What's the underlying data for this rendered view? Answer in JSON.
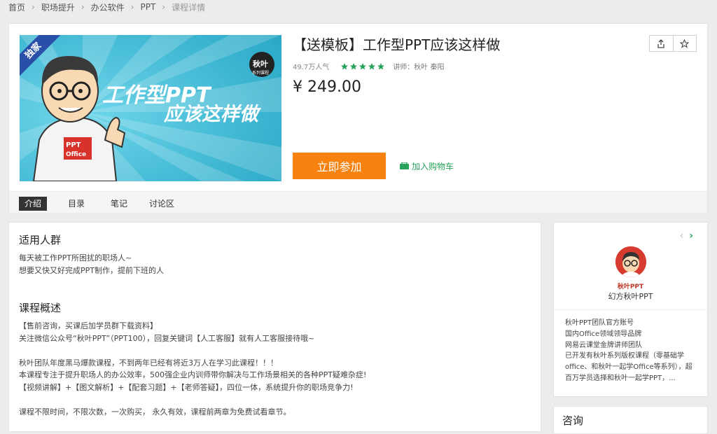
{
  "breadcrumb": [
    "首页",
    "职场提升",
    "办公软件",
    "PPT",
    "课程详情"
  ],
  "cover": {
    "badge": "独家",
    "line1": "工作型PPT",
    "line2": "应该这样做",
    "logo_name": "秋叶",
    "logo_sub": "系列课程",
    "shirt_line1": "PPT",
    "shirt_line2": "Office"
  },
  "course": {
    "title": "【送模板】工作型PPT应该这样做",
    "popularity": "49.7万人气",
    "rating_stars": 5,
    "instructor": "讲师：秋叶 秦阳",
    "price": "¥ 249.00",
    "join_label": "立即参加",
    "cart_label": "加入购物车"
  },
  "actions": {
    "share_icon": "share-icon",
    "favorite_icon": "star-icon"
  },
  "tabs": [
    "介绍",
    "目录",
    "笔记",
    "讨论区"
  ],
  "active_tab": "介绍",
  "intro": {
    "audience_title": "适用人群",
    "audience_lines": [
      "每天被工作PPT所困扰的职场人~",
      "想要又快又好完成PPT制作，提前下班的人"
    ],
    "overview_title": "课程概述",
    "overview_lines": [
      "【售前咨询，买课后加学员群下载资料】",
      "关注微信公众号“秋叶PPT”（PPT100），回复关键词【人工客服】就有人工客服接待哦~",
      "",
      "秋叶团队年度黑马爆款课程，不到两年已经有将近3万人在学习此课程！！！",
      "本课程专注于提升职场人的办公效率，500强企业内训师带你解决与工作场景相关的各种PPT疑难杂症!",
      "【视频讲解】+【图文解析】+【配套习题】+【老师答疑】，四位一体，系统提升你的职场竞争力!",
      "",
      "课程不限时间，不限次数，一次购买， 永久有效，课程前两章为免费试看章节。"
    ]
  },
  "sidebar": {
    "org_badge": "秋叶PPT",
    "org_name": "幻方秋叶PPT",
    "desc_lines": [
      "秋叶PPT团队官方账号",
      "国内Office领域领导品牌",
      "网易云课堂金牌讲师团队",
      "已开发有秋叶系列版权课程（零基础学",
      "office、和秋叶一起学Office等系列），超",
      "百万学员选择和秋叶一起学PPT，..."
    ],
    "prev_label": "‹",
    "next_label": "›",
    "consult_title": "咨询"
  },
  "colors": {
    "accent_orange": "#f7820f",
    "accent_green": "#27a35c",
    "badge_blue": "#2a4fa8",
    "cover_bg": "#37b8d3"
  }
}
